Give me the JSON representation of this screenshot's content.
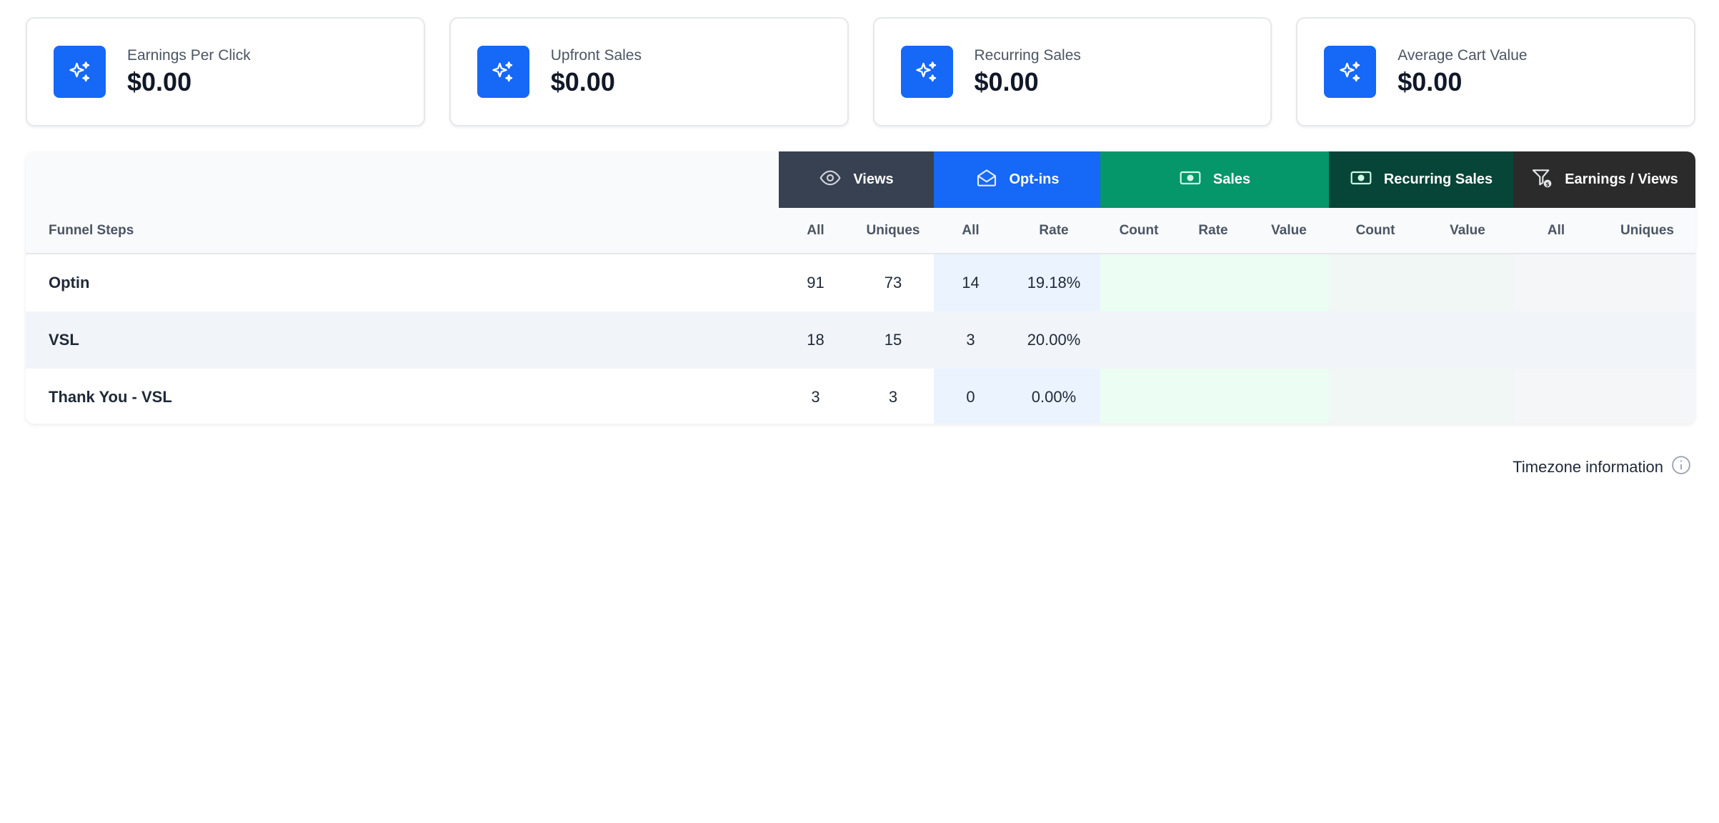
{
  "stats": [
    {
      "label": "Earnings Per Click",
      "value": "$0.00",
      "icon": "sparkles-icon"
    },
    {
      "label": "Upfront Sales",
      "value": "$0.00",
      "icon": "sparkles-icon"
    },
    {
      "label": "Recurring Sales",
      "value": "$0.00",
      "icon": "sparkles-icon"
    },
    {
      "label": "Average Cart Value",
      "value": "$0.00",
      "icon": "sparkles-icon"
    }
  ],
  "table": {
    "groups": {
      "views": {
        "label": "Views",
        "icon": "eye-icon",
        "color": "#374151"
      },
      "optins": {
        "label": "Opt-ins",
        "icon": "envelope-open-icon",
        "color": "#1668f6"
      },
      "sales": {
        "label": "Sales",
        "icon": "banknote-icon",
        "color": "#05966a"
      },
      "recurring": {
        "label": "Recurring Sales",
        "icon": "banknote-icon",
        "color": "#064537"
      },
      "earnings": {
        "label": "Earnings / Views",
        "icon": "funnel-dollar-icon",
        "color": "#2b2b2b"
      }
    },
    "columns": {
      "funnel_steps": "Funnel Steps",
      "views_all": "All",
      "views_uniques": "Uniques",
      "optins_all": "All",
      "optins_rate": "Rate",
      "sales_count": "Count",
      "sales_rate": "Rate",
      "sales_value": "Value",
      "recurring_count": "Count",
      "recurring_value": "Value",
      "earnings_all": "All",
      "earnings_uniques": "Uniques"
    },
    "rows": [
      {
        "step": "Optin",
        "views_all": "91",
        "views_uniques": "73",
        "optins_all": "14",
        "optins_rate": "19.18%"
      },
      {
        "step": "VSL",
        "views_all": "18",
        "views_uniques": "15",
        "optins_all": "3",
        "optins_rate": "20.00%"
      },
      {
        "step": "Thank You - VSL",
        "views_all": "3",
        "views_uniques": "3",
        "optins_all": "0",
        "optins_rate": "0.00%"
      }
    ]
  },
  "timezone": {
    "label": "Timezone information",
    "icon": "info-circle-icon"
  }
}
